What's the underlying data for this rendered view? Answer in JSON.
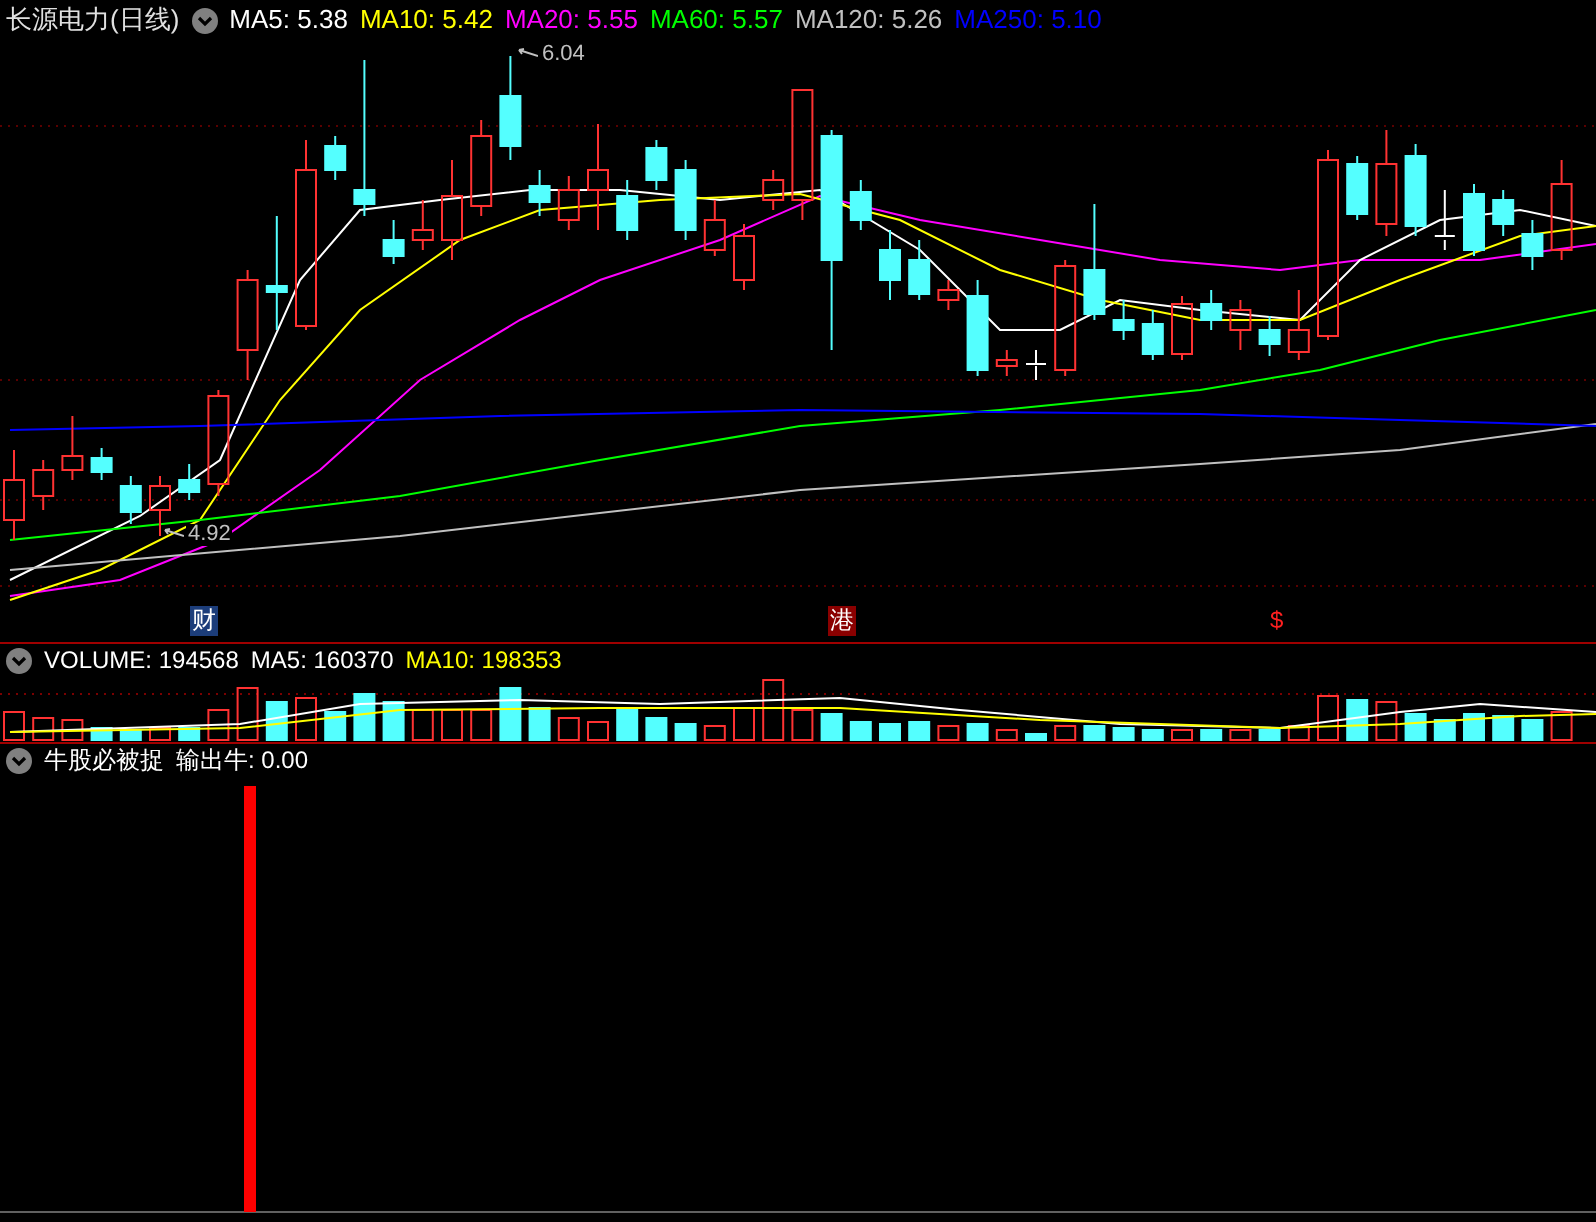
{
  "title": "长源电力(日线)",
  "ma_legend": [
    {
      "label": "MA5: 5.38",
      "color": "#ffffff"
    },
    {
      "label": "MA10: 5.42",
      "color": "#ffff00"
    },
    {
      "label": "MA20: 5.55",
      "color": "#ff00ff"
    },
    {
      "label": "MA60: 5.57",
      "color": "#00ff00"
    },
    {
      "label": "MA120: 5.26",
      "color": "#c0c0c0"
    },
    {
      "label": "MA250: 5.10",
      "color": "#0000ff"
    }
  ],
  "price_labels": [
    {
      "text": "6.04",
      "kind": "high"
    },
    {
      "text": "4.92",
      "kind": "low"
    }
  ],
  "event_markers": [
    {
      "text": "财",
      "kind": "finance"
    },
    {
      "text": "港",
      "kind": "exchange"
    },
    {
      "text": "$",
      "kind": "dividend"
    }
  ],
  "volume": {
    "legend": [
      {
        "label": "VOLUME: 194568",
        "color": "#ffffff"
      },
      {
        "label": "MA5: 160370",
        "color": "#ffffff"
      },
      {
        "label": "MA10: 198353",
        "color": "#ffff00"
      }
    ]
  },
  "indicator": {
    "legend": [
      {
        "label": "牛股必被捉",
        "color": "#ffffff"
      },
      {
        "label": "输出牛: 0.00",
        "color": "#ffffff"
      }
    ]
  }
}
